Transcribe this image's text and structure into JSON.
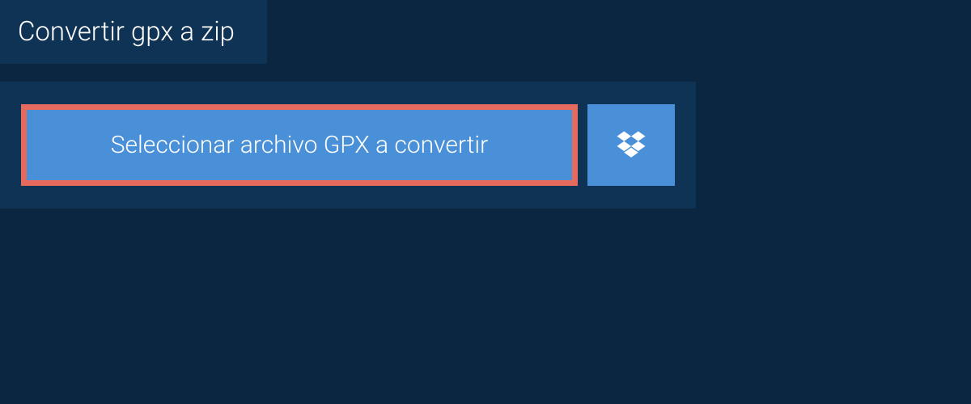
{
  "tab": {
    "title": "Convertir gpx a zip"
  },
  "upload": {
    "select_button_label": "Seleccionar archivo GPX a convertir"
  },
  "colors": {
    "page_bg": "#0a2640",
    "panel_bg": "#0f3355",
    "button_bg": "#4a90d9",
    "highlight_border": "#e56b5f"
  }
}
